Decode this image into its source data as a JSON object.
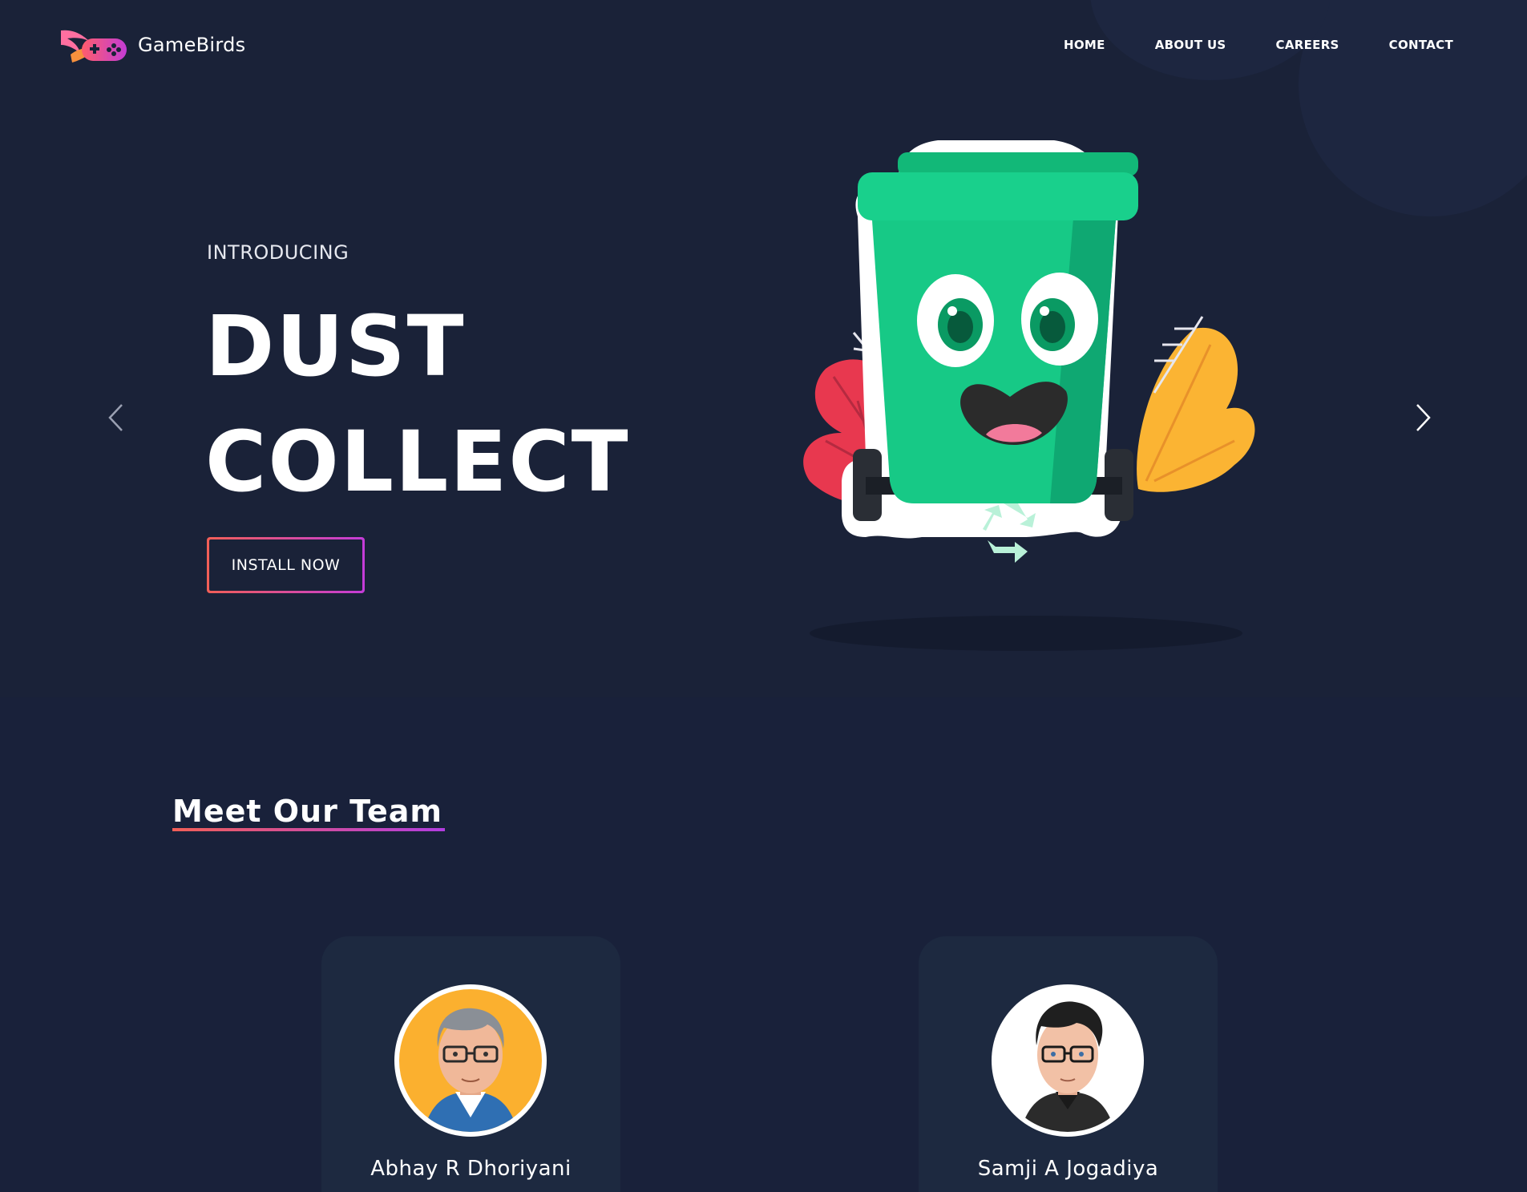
{
  "brand": {
    "name": "GameBirds"
  },
  "nav": {
    "items": [
      "HOME",
      "ABOUT US",
      "CAREERS",
      "CONTACT"
    ]
  },
  "hero": {
    "intro": "INTRODUCING",
    "title_line1": "DUST",
    "title_line2": "COLLECT",
    "cta_label": "INSTALL NOW"
  },
  "team": {
    "heading": "Meet Our Team",
    "members": [
      {
        "name": "Abhay R Dhoriyani"
      },
      {
        "name": "Samji A Jogadiya"
      }
    ]
  },
  "colors": {
    "background": "#19213a",
    "accent_start": "#f25f57",
    "accent_end": "#c43cd8",
    "bin_green": "#17c986"
  }
}
